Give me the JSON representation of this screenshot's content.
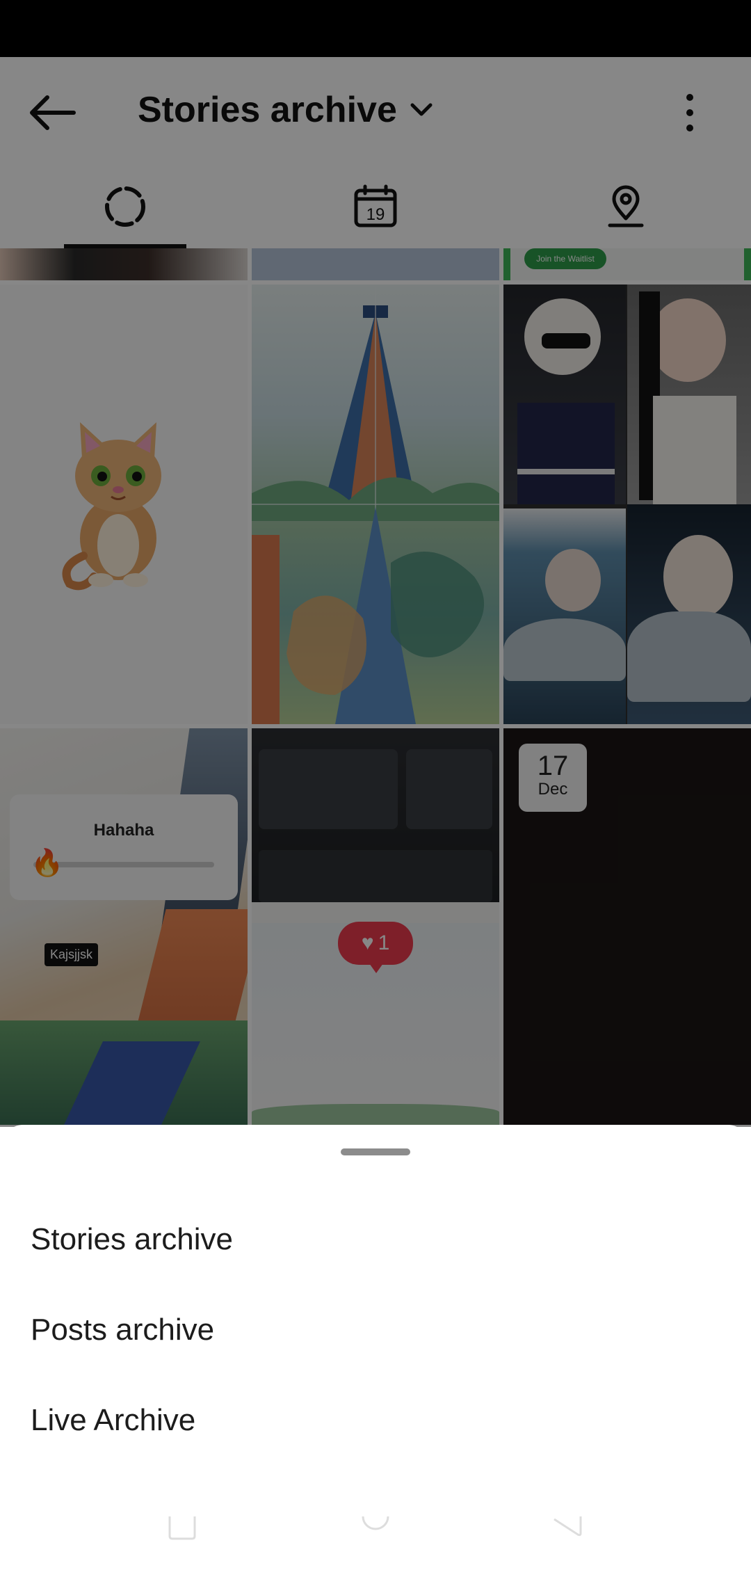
{
  "header": {
    "title": "Stories archive",
    "icons": [
      "back-arrow-icon",
      "chevron-down-icon",
      "more-vertical-icon"
    ]
  },
  "tabs": [
    {
      "name": "stories-tab",
      "icon": "stories-ring-icon",
      "selected": true
    },
    {
      "name": "calendar-tab",
      "icon": "calendar-icon",
      "calendar_day": "19"
    },
    {
      "name": "map-tab",
      "icon": "location-pin-icon"
    }
  ],
  "grid": {
    "pill_text": "Join the Waitlist",
    "poll_question": "Hahaha",
    "poll_emoji": "🔥",
    "text_tag": "Kajsjjsk",
    "like_count": "1",
    "date_badge": {
      "day": "17",
      "month": "Dec"
    }
  },
  "sheet": {
    "options": [
      {
        "label": "Stories archive"
      },
      {
        "label": "Posts archive"
      },
      {
        "label": "Live Archive"
      }
    ]
  },
  "colors": {
    "accent": "#111111",
    "like": "#ee3b4f",
    "overlay": "rgba(0,0,0,0.47)"
  }
}
